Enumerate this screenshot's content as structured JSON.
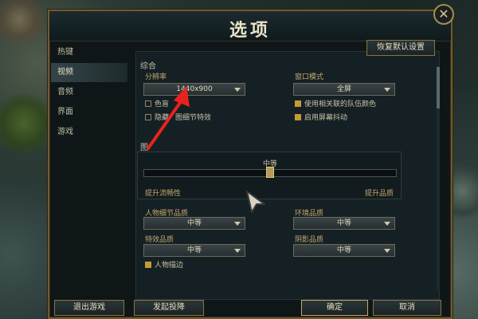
{
  "window": {
    "title": "选项",
    "close_glyph": "✕"
  },
  "sidebar": {
    "items": [
      {
        "label": "热键",
        "active": false
      },
      {
        "label": "视频",
        "active": true
      },
      {
        "label": "音频",
        "active": false
      },
      {
        "label": "界面",
        "active": false
      },
      {
        "label": "游戏",
        "active": false
      }
    ]
  },
  "toolbar": {
    "restore_defaults_label": "恢复默认设置"
  },
  "general": {
    "section_label": "综合",
    "resolution": {
      "label": "分辨率",
      "value": "1440x900"
    },
    "window_mode": {
      "label": "窗口模式",
      "value": "全屏"
    },
    "checkboxes_left": [
      {
        "label": "色盲",
        "checked": false
      },
      {
        "label": "隐藏",
        "checked": false
      }
    ],
    "detail_effects_suffix": "图细节特效",
    "checkboxes_right": [
      {
        "label": "使用相关联的队伍颜色",
        "checked": true
      },
      {
        "label": "启用屏幕抖动",
        "checked": true
      }
    ]
  },
  "graphics": {
    "section_label": "图",
    "preset_value": "中等",
    "preset_level": 0.5,
    "slider_left_label": "提升流畅性",
    "slider_right_label": "提升品质",
    "character_quality": {
      "label": "人物细节品质",
      "value": "中等"
    },
    "environment_quality": {
      "label": "环境品质",
      "value": "中等"
    },
    "effects_quality": {
      "label": "特效品质",
      "value": "中等"
    },
    "shadow_quality": {
      "label": "阴影品质",
      "value": "中等"
    },
    "character_outline": {
      "label": "人物描边",
      "checked": true
    }
  },
  "footer": {
    "exit_game_label": "退出游戏",
    "surrender_label": "发起投降",
    "ok_label": "确定",
    "cancel_label": "取消"
  },
  "annotation": {
    "arrow_color": "#e8231f"
  },
  "colors": {
    "accent_gold": "#c49a34",
    "frame_gold": "#6f5a2f"
  }
}
